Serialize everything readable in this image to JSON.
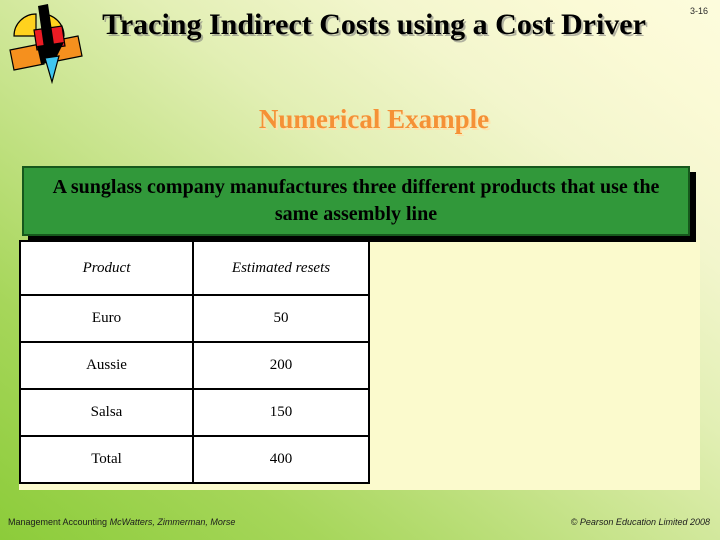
{
  "slide": {
    "number": "3-16",
    "title": "Tracing Indirect Costs using a Cost Driver",
    "subtitle": "Numerical Example",
    "banner_text": "A sunglass company manufactures three different products that use the same assembly line"
  },
  "logo": {
    "name": "abstract-geometric-logo",
    "colors": {
      "yellow": "#FFD21E",
      "red": "#ED1C24",
      "orange": "#F5901E",
      "black": "#000000",
      "cyan": "#3FC6F0"
    }
  },
  "table": {
    "headers": [
      "Product",
      "Estimated resets"
    ],
    "rows": [
      {
        "product": "Euro",
        "value": "50"
      },
      {
        "product": "Aussie",
        "value": "200"
      },
      {
        "product": "Salsa",
        "value": "150"
      },
      {
        "product": "Total",
        "value": "400"
      }
    ]
  },
  "footer": {
    "book": "Management Accounting ",
    "authors": "McWatters, Zimmerman, Morse",
    "copyright": "© Pearson Education Limited 2008"
  },
  "colors": {
    "banner_green": "#31983A",
    "banner_border": "#16581C",
    "subtitle_orange": "#F59136",
    "panel_cream": "#FBFACD",
    "bg_green": "#8CCC3A",
    "bg_cream": "#FDFCDD"
  }
}
